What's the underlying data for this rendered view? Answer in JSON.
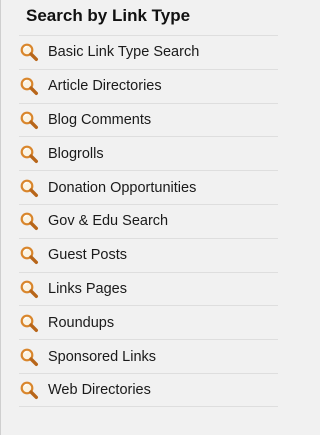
{
  "panel": {
    "title": "Search by Link Type",
    "items": [
      {
        "label": "Basic Link Type Search",
        "icon": "search-icon"
      },
      {
        "label": "Article Directories",
        "icon": "search-icon"
      },
      {
        "label": "Blog Comments",
        "icon": "search-icon"
      },
      {
        "label": "Blogrolls",
        "icon": "search-icon"
      },
      {
        "label": "Donation Opportunities",
        "icon": "search-icon"
      },
      {
        "label": "Gov & Edu Search",
        "icon": "search-icon"
      },
      {
        "label": "Guest Posts",
        "icon": "search-icon"
      },
      {
        "label": "Links Pages",
        "icon": "search-icon"
      },
      {
        "label": "Roundups",
        "icon": "search-icon"
      },
      {
        "label": "Sponsored Links",
        "icon": "search-icon"
      },
      {
        "label": "Web Directories",
        "icon": "search-icon"
      }
    ]
  },
  "colors": {
    "background": "#f1f1f1",
    "divider": "#dedede",
    "icon_accent": "#d9862c"
  }
}
